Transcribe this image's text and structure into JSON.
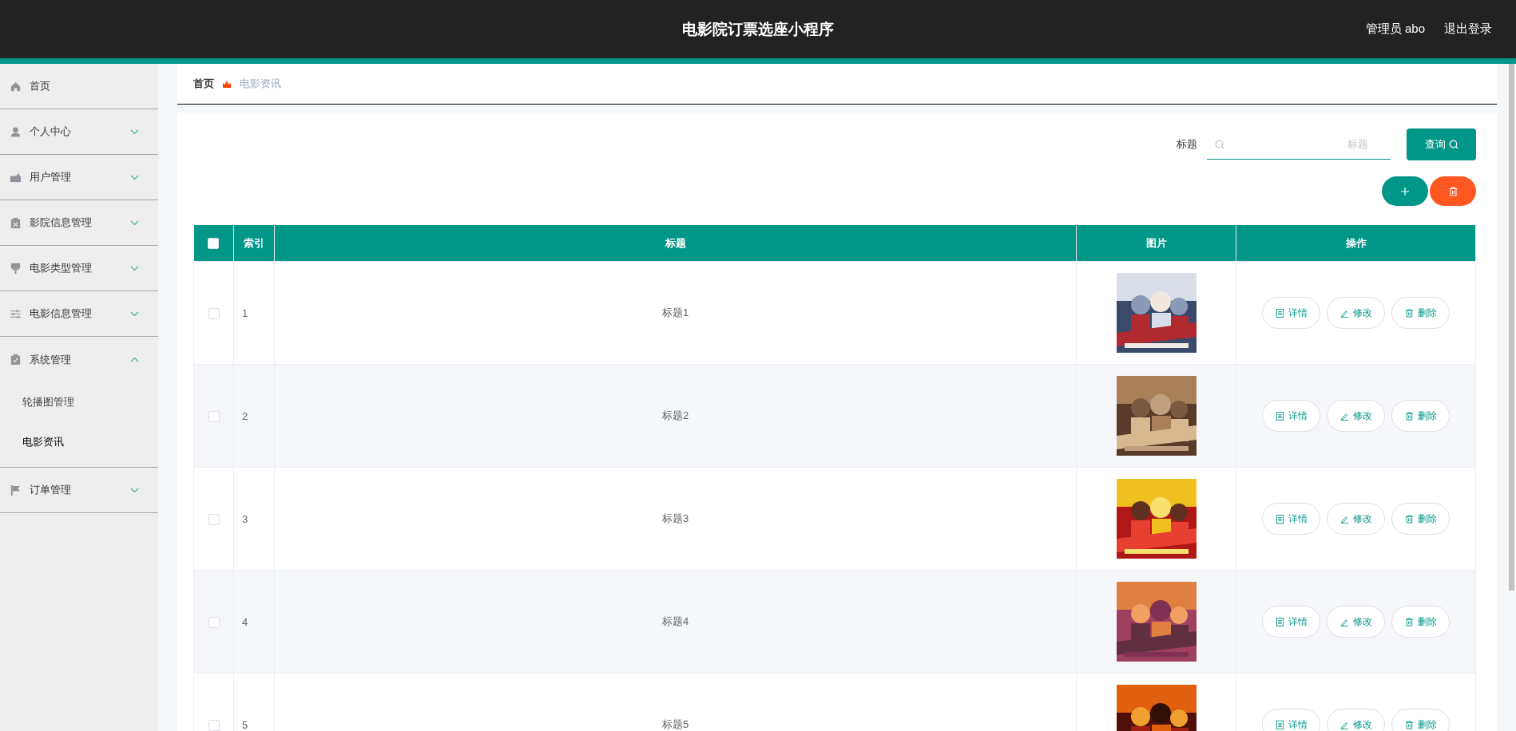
{
  "header": {
    "title": "电影院订票选座小程序",
    "user": "管理员 abo",
    "logout": "退出登录"
  },
  "sidebar": {
    "items": [
      {
        "label": "首页",
        "kind": "link"
      },
      {
        "label": "个人中心",
        "kind": "submenu",
        "expanded": false
      },
      {
        "label": "用户管理",
        "kind": "submenu",
        "expanded": false
      },
      {
        "label": "影院信息管理",
        "kind": "submenu",
        "expanded": false
      },
      {
        "label": "电影类型管理",
        "kind": "submenu",
        "expanded": false
      },
      {
        "label": "电影信息管理",
        "kind": "submenu",
        "expanded": false
      },
      {
        "label": "系统管理",
        "kind": "submenu",
        "expanded": true,
        "children": [
          {
            "label": "轮播图管理",
            "selected": false
          },
          {
            "label": "电影资讯",
            "selected": true
          }
        ]
      },
      {
        "label": "订单管理",
        "kind": "submenu",
        "expanded": false
      }
    ]
  },
  "breadcrumb": [
    "首页",
    "电影资讯"
  ],
  "search": {
    "label": "标题",
    "placeholder": "标题",
    "button": "查询"
  },
  "table": {
    "header_checked": false,
    "columns": [
      "索引",
      "标题",
      "图片",
      "操作"
    ],
    "rows": [
      {
        "checked": false,
        "index": "1",
        "title": "标题1",
        "image": {
          "kind": "picture"
        },
        "actions": [
          "详情",
          "修改",
          "删除"
        ]
      },
      {
        "checked": false,
        "index": "2",
        "title": "标题2",
        "image": {
          "kind": "picture"
        },
        "actions": [
          "详情",
          "修改",
          "删除"
        ]
      },
      {
        "checked": false,
        "index": "3",
        "title": "标题3",
        "image": {
          "kind": "picture"
        },
        "actions": [
          "详情",
          "修改",
          "删除"
        ]
      },
      {
        "checked": false,
        "index": "4",
        "title": "标题4",
        "image": {
          "kind": "picture"
        },
        "actions": [
          "详情",
          "修改",
          "删除"
        ]
      },
      {
        "checked": false,
        "index": "5",
        "title": "标题5",
        "image": {
          "kind": "picture"
        },
        "actions": [
          "详情",
          "修改",
          "删除"
        ]
      }
    ]
  }
}
